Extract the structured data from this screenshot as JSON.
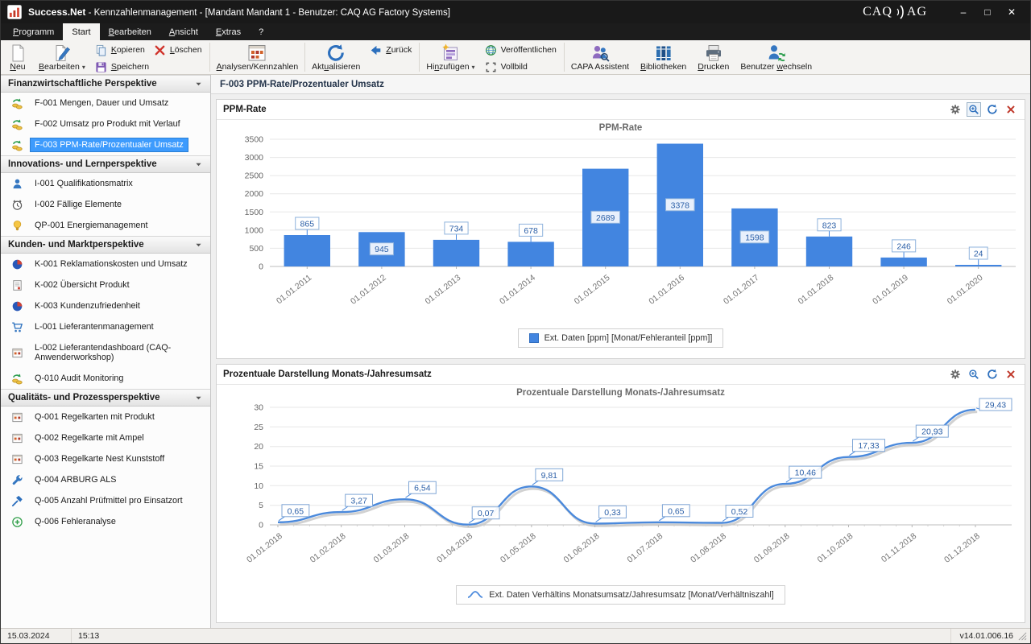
{
  "window": {
    "app_name": "Success.Net",
    "title_rest": " - Kennzahlenmanagement - [Mandant Mandant 1 - Benutzer: CAQ AG Factory Systems]",
    "logo_left": "CAQ",
    "logo_right": "AG",
    "controls": {
      "minimize": "–",
      "maximize": "□",
      "close": "✕"
    }
  },
  "menubar": {
    "items": [
      {
        "label": "Programm",
        "u": 0,
        "active": false
      },
      {
        "label": "Start",
        "u": -1,
        "active": true
      },
      {
        "label": "Bearbeiten",
        "u": 0,
        "active": false
      },
      {
        "label": "Ansicht",
        "u": 0,
        "active": false
      },
      {
        "label": "Extras",
        "u": 0,
        "active": false
      },
      {
        "label": "?",
        "u": -1,
        "active": false
      }
    ]
  },
  "toolbar": {
    "groups": [
      {
        "cells": [
          {
            "type": "big",
            "label": "Neu",
            "u": 0,
            "icon": "new-document"
          },
          {
            "type": "big",
            "label": "Bearbeiten",
            "u": 0,
            "icon": "edit-document",
            "dropdown": true
          },
          {
            "type": "col",
            "rows": [
              [
                {
                  "label": "Kopieren",
                  "u": 0,
                  "icon": "copy"
                },
                {
                  "label": "Löschen",
                  "u": 0,
                  "icon": "delete"
                }
              ],
              [
                {
                  "label": "Speichern",
                  "u": 0,
                  "icon": "save"
                }
              ]
            ]
          }
        ]
      },
      {
        "cells": [
          {
            "type": "big",
            "label": "Analysen/Kennzahlen",
            "u": 0,
            "icon": "analyses"
          }
        ]
      },
      {
        "cells": [
          {
            "type": "big",
            "label": "Aktualisieren",
            "u": 3,
            "icon": "refresh"
          },
          {
            "type": "col",
            "rows": [
              [
                {
                  "label": "Zurück",
                  "u": 0,
                  "icon": "back"
                }
              ]
            ]
          }
        ]
      },
      {
        "cells": [
          {
            "type": "big",
            "label": "Hinzufügen",
            "u": 2,
            "icon": "add",
            "dropdown": true
          },
          {
            "type": "col",
            "rows": [
              [
                {
                  "label": "Veröffentlichen",
                  "u": -1,
                  "icon": "publish"
                }
              ],
              [
                {
                  "label": "Vollbild",
                  "u": -1,
                  "icon": "fullscreen"
                }
              ]
            ]
          }
        ]
      },
      {
        "cells": [
          {
            "type": "big",
            "label": "CAPA Assistent",
            "u": -1,
            "icon": "capa"
          },
          {
            "type": "big",
            "label": "Bibliotheken",
            "u": 0,
            "icon": "libraries"
          },
          {
            "type": "big",
            "label": "Drucken",
            "u": 0,
            "icon": "print"
          },
          {
            "type": "big",
            "label": "Benutzer wechseln",
            "u": 9,
            "icon": "switch-user"
          }
        ]
      }
    ]
  },
  "sidebar": {
    "sections": [
      {
        "title": "Finanzwirtschaftliche Perspektive",
        "items": [
          {
            "label": "F-001 Mengen, Dauer und Umsatz",
            "icon": "money-flow",
            "selected": false
          },
          {
            "label": "F-002 Umsatz pro Produkt mit Verlauf",
            "icon": "money-flow",
            "selected": false
          },
          {
            "label": "F-003 PPM-Rate/Prozentualer Umsatz",
            "icon": "money-flow",
            "selected": true
          }
        ]
      },
      {
        "title": "Innovations- und Lernperspektive",
        "items": [
          {
            "label": "I-001 Qualifikationsmatrix",
            "icon": "person",
            "selected": false
          },
          {
            "label": "I-002 Fällige Elemente",
            "icon": "clock",
            "selected": false
          },
          {
            "label": "QP-001 Energiemanagement",
            "icon": "bulb",
            "selected": false
          }
        ]
      },
      {
        "title": "Kunden- und Marktperspektive",
        "items": [
          {
            "label": "K-001 Reklamationskosten und Umsatz",
            "icon": "pie",
            "selected": false
          },
          {
            "label": "K-002 Übersicht Produkt",
            "icon": "doc",
            "selected": false
          },
          {
            "label": "K-003 Kundenzufriedenheit",
            "icon": "pie",
            "selected": false
          },
          {
            "label": "L-001 Lieferantenmanagement",
            "icon": "cart",
            "selected": false
          },
          {
            "label": "L-002 Lieferantendashboard (CAQ-Anwenderworkshop)",
            "icon": "dashboard",
            "selected": false
          },
          {
            "label": "Q-010 Audit Monitoring",
            "icon": "money-flow",
            "selected": false
          }
        ]
      },
      {
        "title": "Qualitäts- und Prozessperspektive",
        "items": [
          {
            "label": "Q-001 Regelkarten mit Produkt",
            "icon": "dashboard",
            "selected": false
          },
          {
            "label": "Q-002 Regelkarte mit Ampel",
            "icon": "dashboard",
            "selected": false
          },
          {
            "label": "Q-003 Regelkarte Nest Kunststoff",
            "icon": "dashboard",
            "selected": false
          },
          {
            "label": "Q-004 ARBURG ALS",
            "icon": "wrench",
            "selected": false
          },
          {
            "label": "Q-005 Anzahl Prüfmittel pro Einsatzort",
            "icon": "hammer",
            "selected": false
          },
          {
            "label": "Q-006 Fehleranalyse",
            "icon": "plus-circle",
            "selected": false
          }
        ]
      }
    ]
  },
  "content": {
    "page_title": "F-003 PPM-Rate/Prozentualer Umsatz",
    "panels": [
      {
        "header": "PPM-Rate",
        "zoom_boxed": true,
        "icons": [
          "gear",
          "zoom-in",
          "refresh-sm",
          "close-sm"
        ]
      },
      {
        "header": "Prozentuale Darstellung Monats-/Jahresumsatz",
        "zoom_boxed": false,
        "icons": [
          "gear",
          "zoom-in",
          "refresh-sm",
          "close-sm"
        ]
      }
    ]
  },
  "chart_data": [
    {
      "type": "bar",
      "title": "PPM-Rate",
      "categories": [
        "01.01.2011",
        "01.01.2012",
        "01.01.2013",
        "01.01.2014",
        "01.01.2015",
        "01.01.2016",
        "01.01.2017",
        "01.01.2018",
        "01.01.2019",
        "01.01.2020"
      ],
      "values": [
        865,
        945,
        734,
        678,
        2689,
        3378,
        1598,
        823,
        246,
        24
      ],
      "labels": [
        "865",
        "945",
        "734",
        "678",
        "2689",
        "3378",
        "1598",
        "823",
        "246",
        "24"
      ],
      "ylim": [
        0,
        3500
      ],
      "ytick": 500,
      "grid": true,
      "legend": "Ext. Daten [ppm] [Monat/Fehleranteil [ppm]]",
      "legend_position": "bottom-center",
      "color": "#4285e0"
    },
    {
      "type": "line",
      "title": "Prozentuale Darstellung Monats-/Jahresumsatz",
      "categories": [
        "01.01.2018",
        "01.02.2018",
        "01.03.2018",
        "01.04.2018",
        "01.05.2018",
        "01.06.2018",
        "01.07.2018",
        "01.08.2018",
        "01.09.2018",
        "01.10.2018",
        "01.11.2018",
        "01.12.2018"
      ],
      "values": [
        0.65,
        3.27,
        6.54,
        0.07,
        9.81,
        0.33,
        0.65,
        0.52,
        10.46,
        17.33,
        20.93,
        29.43
      ],
      "labels": [
        "0,65",
        "3,27",
        "6,54",
        "0,07",
        "9,81",
        "0,33",
        "0,65",
        "0,52",
        "10,46",
        "17,33",
        "20,93",
        "29,43"
      ],
      "ylim": [
        0,
        30
      ],
      "ytick": 5,
      "grid": true,
      "legend": "Ext. Daten Verhältins Monatsumsatz/Jahresumsatz [Monat/Verhältniszahl]",
      "legend_position": "bottom-center",
      "color": "#4a89dc"
    }
  ],
  "statusbar": {
    "date": "15.03.2024",
    "time": "15:13",
    "version": "v14.01.006.16"
  }
}
